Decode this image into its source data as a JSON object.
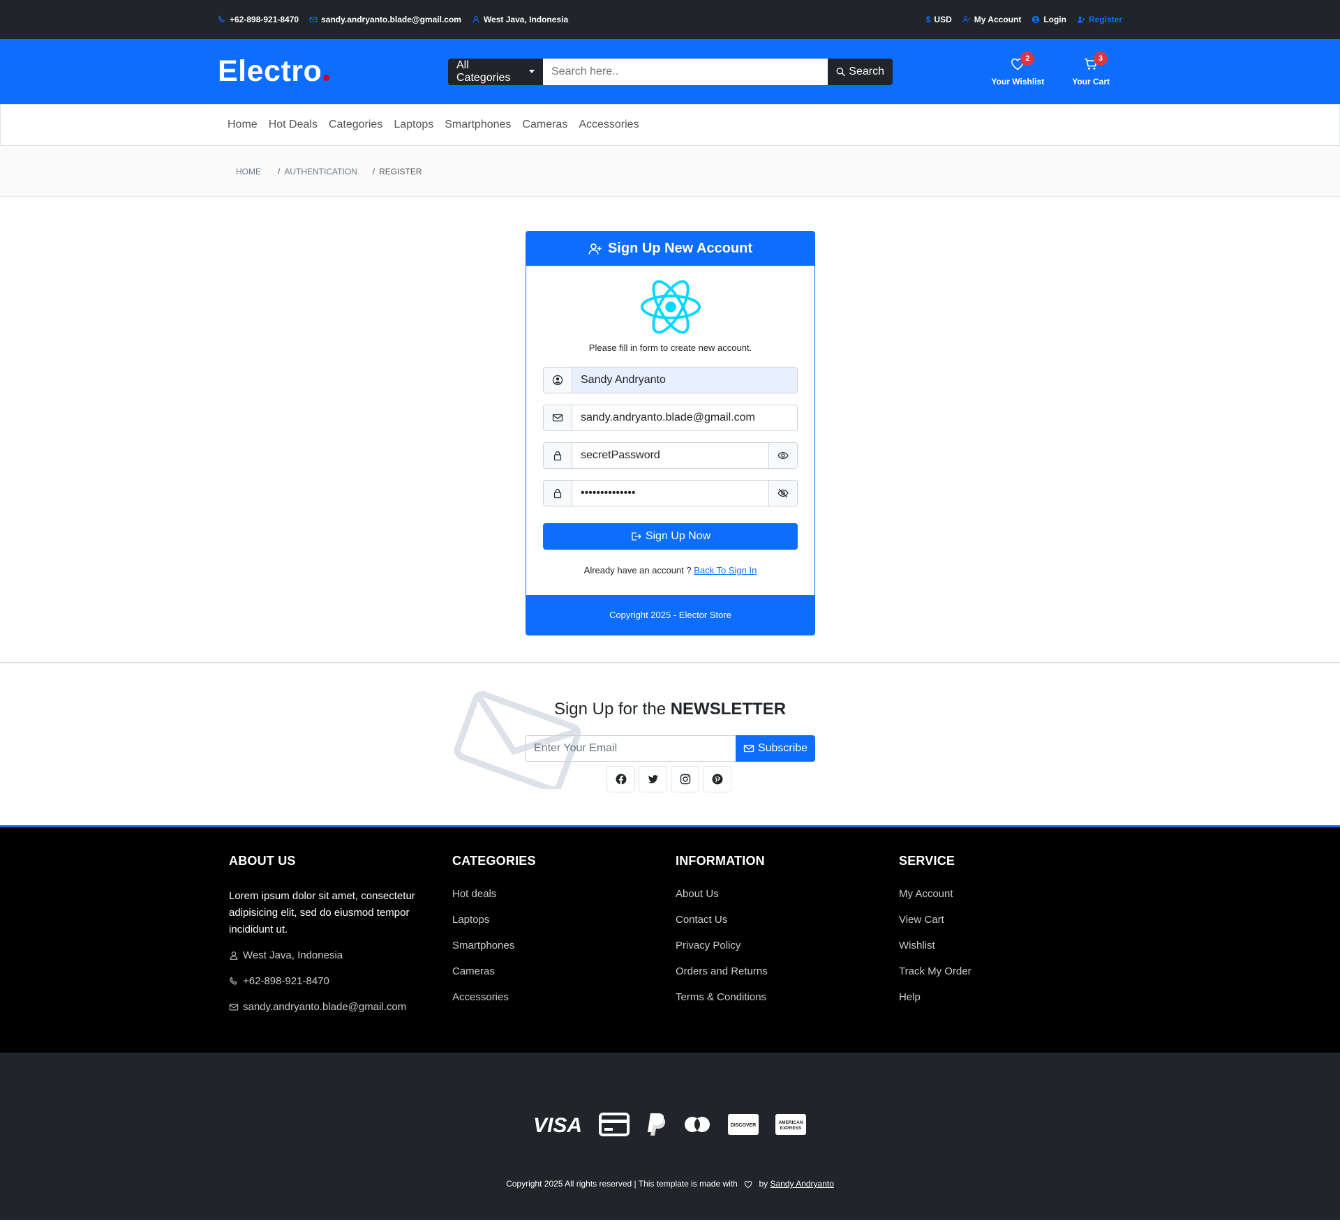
{
  "topbar": {
    "phone": "+62-898-921-8470",
    "email": "sandy.andryanto.blade@gmail.com",
    "location": "West Java, Indonesia",
    "currency": "USD",
    "my_account": "My Account",
    "login": "Login",
    "register": "Register"
  },
  "header": {
    "logo": "Electro",
    "category_label": "All Categories",
    "search_placeholder": "Search here..",
    "search_button": "Search",
    "wishlist_label": "Your Wishlist",
    "wishlist_count": "2",
    "cart_label": "Your Cart",
    "cart_count": "3"
  },
  "nav": {
    "items": [
      "Home",
      "Hot Deals",
      "Categories",
      "Laptops",
      "Smartphones",
      "Cameras",
      "Accessories"
    ]
  },
  "breadcrumb": {
    "items": [
      "HOME",
      "AUTHENTICATION",
      "REGISTER"
    ]
  },
  "signup": {
    "title": "Sign Up New Account",
    "intro": "Please fill in form to create new account.",
    "name_value": "Sandy Andryanto",
    "email_value": "sandy.andryanto.blade@gmail.com",
    "password_value": "secretPassword",
    "confirm_value": "••••••••••••••",
    "submit_label": "Sign Up Now",
    "already_text": "Already have an account ?",
    "back_link": "Back To Sign In",
    "footer": "Copyright 2025 - Elector Store"
  },
  "newsletter": {
    "title_prefix": "Sign Up for the",
    "title_strong": "NEWSLETTER",
    "input_placeholder": "Enter Your Email",
    "button": "Subscribe",
    "socials": [
      "facebook-icon",
      "twitter-icon",
      "instagram-icon",
      "pinterest-icon"
    ]
  },
  "footer": {
    "about": {
      "heading": "ABOUT US",
      "text": "Lorem ipsum dolor sit amet, consectetur adipisicing elit, sed do eiusmod tempor incididunt ut.",
      "location": "West Java, Indonesia",
      "phone": "+62-898-921-8470",
      "email": "sandy.andryanto.blade@gmail.com"
    },
    "categories": {
      "heading": "CATEGORIES",
      "links": [
        "Hot deals",
        "Laptops",
        "Smartphones",
        "Cameras",
        "Accessories"
      ]
    },
    "information": {
      "heading": "INFORMATION",
      "links": [
        "About Us",
        "Contact Us",
        "Privacy Policy",
        "Orders and Returns",
        "Terms & Conditions"
      ]
    },
    "service": {
      "heading": "SERVICE",
      "links": [
        "My Account",
        "View Cart",
        "Wishlist",
        "Track My Order",
        "Help"
      ]
    }
  },
  "bottom": {
    "payments": [
      "visa-icon",
      "credit-card-icon",
      "paypal-icon",
      "mastercard-icon",
      "discover-icon",
      "amex-icon"
    ],
    "copyright_prefix": "Copyright 2025 All rights reserved | This template is made with",
    "by": "by",
    "author": "Sandy Andryanto"
  },
  "colors": {
    "primary": "#0d6efd",
    "dark": "#212529",
    "accent_dot": "#d10024",
    "badge": "#dc3545",
    "react": "#00d8ff"
  }
}
